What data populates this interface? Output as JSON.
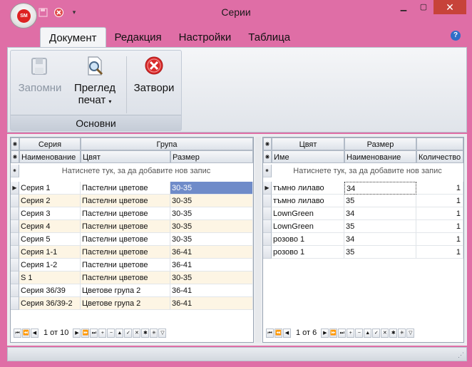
{
  "window": {
    "title": "Серии"
  },
  "ribbon": {
    "tabs": [
      "Документ",
      "Редакция",
      "Настройки",
      "Таблица"
    ],
    "group_name": "Основни",
    "buttons": {
      "save": "Запомни",
      "preview_line1": "Преглед",
      "preview_line2": "печат",
      "close": "Затвори"
    }
  },
  "left_grid": {
    "band_headers": [
      "Серия",
      "Група"
    ],
    "columns": [
      "Наименование",
      "Цвят",
      "Размер"
    ],
    "new_row_text": "Натиснете тук, за да добавите нов запис",
    "rows": [
      [
        "Серия 1",
        "Пастелни цветове",
        "30-35"
      ],
      [
        "Серия 2",
        "Пастелни цветове",
        "30-35"
      ],
      [
        "Серия 3",
        "Пастелни цветове",
        "30-35"
      ],
      [
        "Серия 4",
        "Пастелни цветове",
        "30-35"
      ],
      [
        "Серия 5",
        "Пастелни цветове",
        "30-35"
      ],
      [
        "Серия 1-1",
        "Пастелни цветове",
        "36-41"
      ],
      [
        "Серия 1-2",
        "Пастелни цветове",
        "36-41"
      ],
      [
        "S 1",
        "Пастелни цветове",
        "30-35"
      ],
      [
        "Серия 36/39",
        "Цветове група 2",
        "36-41"
      ],
      [
        "Серия 36/39-2",
        "Цветове група 2",
        "36-41"
      ]
    ],
    "pager": "1 от 10"
  },
  "right_grid": {
    "band_headers": [
      "Цвят",
      "Размер"
    ],
    "columns": [
      "Име",
      "Наименование",
      "Количество"
    ],
    "new_row_text": "Натиснете тук, за да добавите нов запис",
    "rows": [
      [
        "тъмно лилаво",
        "34",
        "1"
      ],
      [
        "тъмно лилаво",
        "35",
        "1"
      ],
      [
        "LownGreen",
        "34",
        "1"
      ],
      [
        "LownGreen",
        "35",
        "1"
      ],
      [
        "розово 1",
        "34",
        "1"
      ],
      [
        "розово 1",
        "35",
        "1"
      ]
    ],
    "pager": "1 от 6"
  },
  "icons": {
    "app": "SM",
    "qat": [
      "save-icon",
      "close-icon",
      "dropdown-icon"
    ],
    "window_controls": [
      "minimize-icon",
      "maximize-icon",
      "close-icon"
    ]
  },
  "colors": {
    "title_bar": "#df6ea6",
    "selected_cell": "#6f8bc9",
    "alt_row": "#fdf5e4",
    "close_red": "#d22"
  }
}
